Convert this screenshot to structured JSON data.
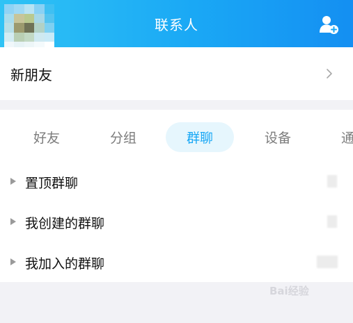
{
  "header": {
    "title": "联系人",
    "icons": {
      "avatar": "user-avatar",
      "add": "add-contact-icon"
    }
  },
  "new_friends": {
    "label": "新朋友",
    "icon": "chevron-right-icon"
  },
  "tabs": [
    {
      "label": "好友",
      "active": false
    },
    {
      "label": "分组",
      "active": false
    },
    {
      "label": "群聊",
      "active": true
    },
    {
      "label": "设备",
      "active": false
    },
    {
      "label": "通",
      "active": false
    }
  ],
  "groups": [
    {
      "label": "置顶群聊"
    },
    {
      "label": "我创建的群聊"
    },
    {
      "label": "我加入的群聊"
    }
  ],
  "watermark": "Bai经验",
  "colors": {
    "header_start": "#2fc3f5",
    "header_end": "#148ff2",
    "accent": "#1aa8f5",
    "active_tab_bg": "#e6f6fd"
  }
}
